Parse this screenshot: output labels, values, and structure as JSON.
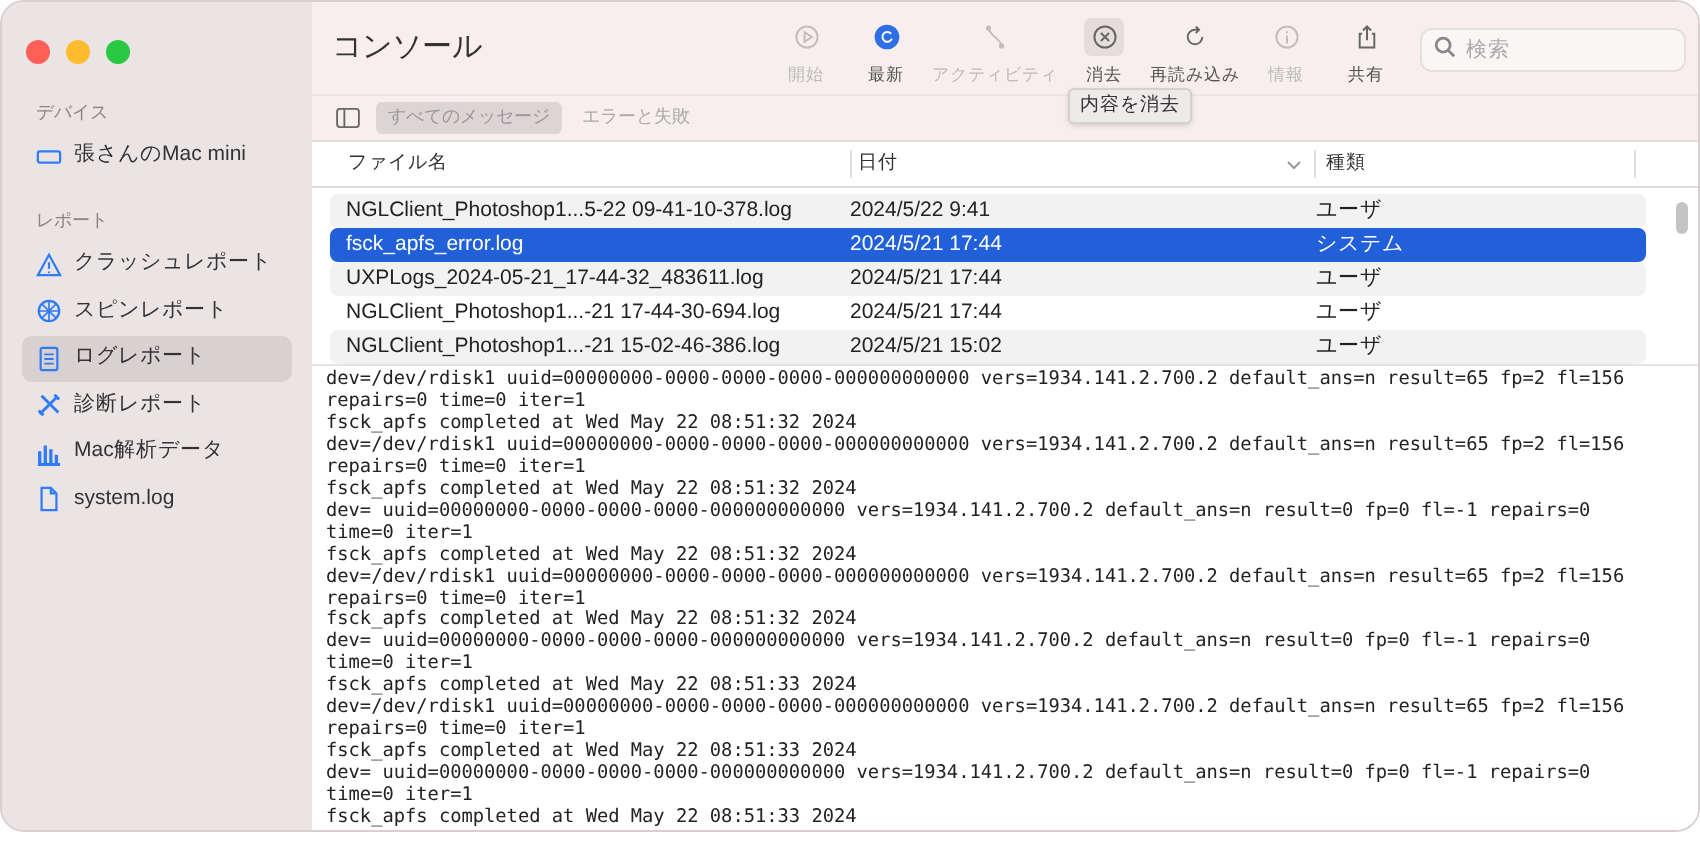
{
  "window": {
    "title": "コンソール"
  },
  "sidebar": {
    "sections": [
      {
        "heading": "デバイス",
        "items": [
          {
            "label": "張さんのMac mini",
            "selected": false
          }
        ]
      },
      {
        "heading": "レポート",
        "items": [
          {
            "label": "クラッシュレポート",
            "selected": false
          },
          {
            "label": "スピンレポート",
            "selected": false
          },
          {
            "label": "ログレポート",
            "selected": true
          },
          {
            "label": "診断レポート",
            "selected": false
          },
          {
            "label": "Mac解析データ",
            "selected": false
          },
          {
            "label": "system.log",
            "selected": false
          }
        ]
      }
    ]
  },
  "toolbar": [
    {
      "label": "開始",
      "disabled": true,
      "active": false
    },
    {
      "label": "最新",
      "disabled": false,
      "active": true
    },
    {
      "label": "アクティビティ",
      "disabled": true,
      "active": false
    },
    {
      "label": "消去",
      "disabled": false,
      "active": false
    },
    {
      "label": "再読み込み",
      "disabled": false,
      "active": false
    },
    {
      "label": "情報",
      "disabled": true,
      "active": false
    },
    {
      "label": "共有",
      "disabled": false,
      "active": false
    }
  ],
  "tooltip": "内容を消去",
  "search": {
    "placeholder": "検索"
  },
  "filters": [
    {
      "label": "すべてのメッセージ",
      "selected": true
    },
    {
      "label": "エラーと失敗",
      "selected": false
    }
  ],
  "table": {
    "columns": [
      "ファイル名",
      "日付",
      "種類"
    ],
    "rows": [
      {
        "cells": [
          "NGLClient_Photoshop1...5-22 09-41-10-378.log",
          "2024/5/22 9:41",
          "ユーザ"
        ],
        "selected": false
      },
      {
        "cells": [
          "fsck_apfs_error.log",
          "2024/5/21 17:44",
          "システム"
        ],
        "selected": true
      },
      {
        "cells": [
          "UXPLogs_2024-05-21_17-44-32_483611.log",
          "2024/5/21 17:44",
          "ユーザ"
        ],
        "selected": false
      },
      {
        "cells": [
          "NGLClient_Photoshop1...-21 17-44-30-694.log",
          "2024/5/21 17:44",
          "ユーザ"
        ],
        "selected": false
      },
      {
        "cells": [
          "NGLClient_Photoshop1...-21 15-02-46-386.log",
          "2024/5/21 15:02",
          "ユーザ"
        ],
        "selected": false
      }
    ]
  },
  "log_lines": [
    "dev=/dev/rdisk1 uuid=00000000-0000-0000-0000-000000000000 vers=1934.141.2.700.2 default_ans=n result=65 fp=2 fl=156",
    "repairs=0 time=0 iter=1",
    "fsck_apfs completed at Wed May 22 08:51:32 2024",
    "dev=/dev/rdisk1 uuid=00000000-0000-0000-0000-000000000000 vers=1934.141.2.700.2 default_ans=n result=65 fp=2 fl=156",
    "repairs=0 time=0 iter=1",
    "fsck_apfs completed at Wed May 22 08:51:32 2024",
    "dev= uuid=00000000-0000-0000-0000-000000000000 vers=1934.141.2.700.2 default_ans=n result=0 fp=0 fl=-1 repairs=0",
    "time=0 iter=1",
    "fsck_apfs completed at Wed May 22 08:51:32 2024",
    "dev=/dev/rdisk1 uuid=00000000-0000-0000-0000-000000000000 vers=1934.141.2.700.2 default_ans=n result=65 fp=2 fl=156",
    "repairs=0 time=0 iter=1",
    "fsck_apfs completed at Wed May 22 08:51:32 2024",
    "dev= uuid=00000000-0000-0000-0000-000000000000 vers=1934.141.2.700.2 default_ans=n result=0 fp=0 fl=-1 repairs=0",
    "time=0 iter=1",
    "fsck_apfs completed at Wed May 22 08:51:33 2024",
    "dev=/dev/rdisk1 uuid=00000000-0000-0000-0000-000000000000 vers=1934.141.2.700.2 default_ans=n result=65 fp=2 fl=156",
    "repairs=0 time=0 iter=1",
    "fsck_apfs completed at Wed May 22 08:51:33 2024",
    "dev= uuid=00000000-0000-0000-0000-000000000000 vers=1934.141.2.700.2 default_ans=n result=0 fp=0 fl=-1 repairs=0",
    "time=0 iter=1",
    "fsck_apfs completed at Wed May 22 08:51:33 2024"
  ]
}
